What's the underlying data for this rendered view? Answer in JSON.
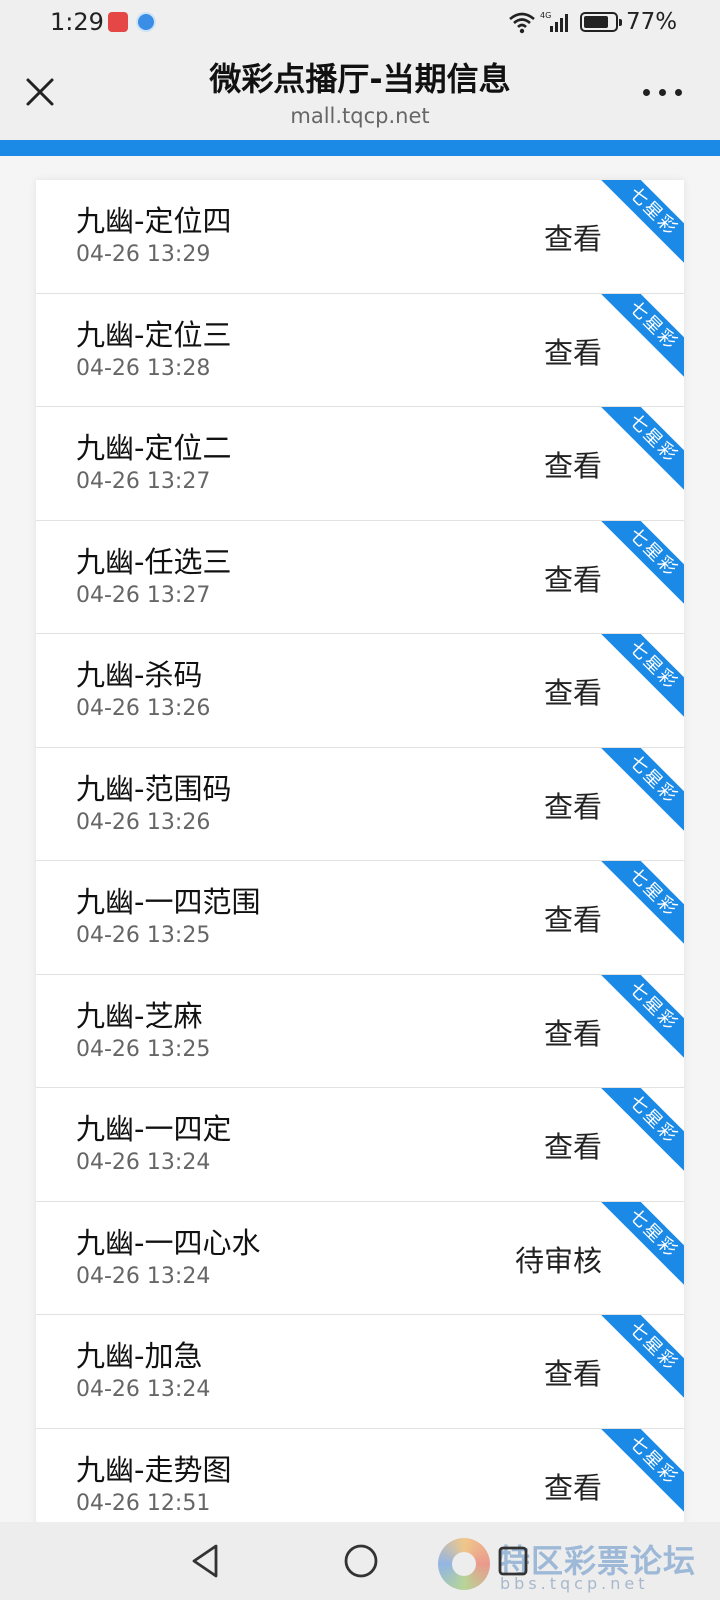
{
  "status_bar": {
    "time": "1:29",
    "battery_percent": "77%",
    "battery_level": 0.77,
    "icons": [
      "notification-app-icon",
      "browser-app-icon",
      "wifi-icon",
      "signal-icon",
      "battery-icon"
    ]
  },
  "header": {
    "title": "微彩点播厅-当期信息",
    "url": "mall.tqcp.net",
    "close_icon": "close-icon",
    "more_icon": "more-dots-icon"
  },
  "colors": {
    "accent": "#1b8ae6",
    "background": "#f5f5f5",
    "card": "#ffffff"
  },
  "items": [
    {
      "title": "九幽-定位四",
      "time": "04-26 13:29",
      "action": "查看",
      "tag": "七星彩"
    },
    {
      "title": "九幽-定位三",
      "time": "04-26 13:28",
      "action": "查看",
      "tag": "七星彩"
    },
    {
      "title": "九幽-定位二",
      "time": "04-26 13:27",
      "action": "查看",
      "tag": "七星彩"
    },
    {
      "title": "九幽-任选三",
      "time": "04-26 13:27",
      "action": "查看",
      "tag": "七星彩"
    },
    {
      "title": "九幽-杀码",
      "time": "04-26 13:26",
      "action": "查看",
      "tag": "七星彩"
    },
    {
      "title": "九幽-范围码",
      "time": "04-26 13:26",
      "action": "查看",
      "tag": "七星彩"
    },
    {
      "title": "九幽-一四范围",
      "time": "04-26 13:25",
      "action": "查看",
      "tag": "七星彩"
    },
    {
      "title": "九幽-芝麻",
      "time": "04-26 13:25",
      "action": "查看",
      "tag": "七星彩"
    },
    {
      "title": "九幽-一四定",
      "time": "04-26 13:24",
      "action": "查看",
      "tag": "七星彩"
    },
    {
      "title": "九幽-一四心水",
      "time": "04-26 13:24",
      "action": "待审核",
      "tag": "七星彩"
    },
    {
      "title": "九幽-加急",
      "time": "04-26 13:24",
      "action": "查看",
      "tag": "七星彩"
    },
    {
      "title": "九幽-走势图",
      "time": "04-26 12:51",
      "action": "查看",
      "tag": "七星彩"
    }
  ],
  "nav_bar": {
    "icons": [
      "back-triangle-icon",
      "home-circle-icon",
      "recent-square-icon"
    ]
  },
  "watermark": {
    "text": "特区彩票论坛",
    "sub": "bbs.tqcp.net"
  }
}
